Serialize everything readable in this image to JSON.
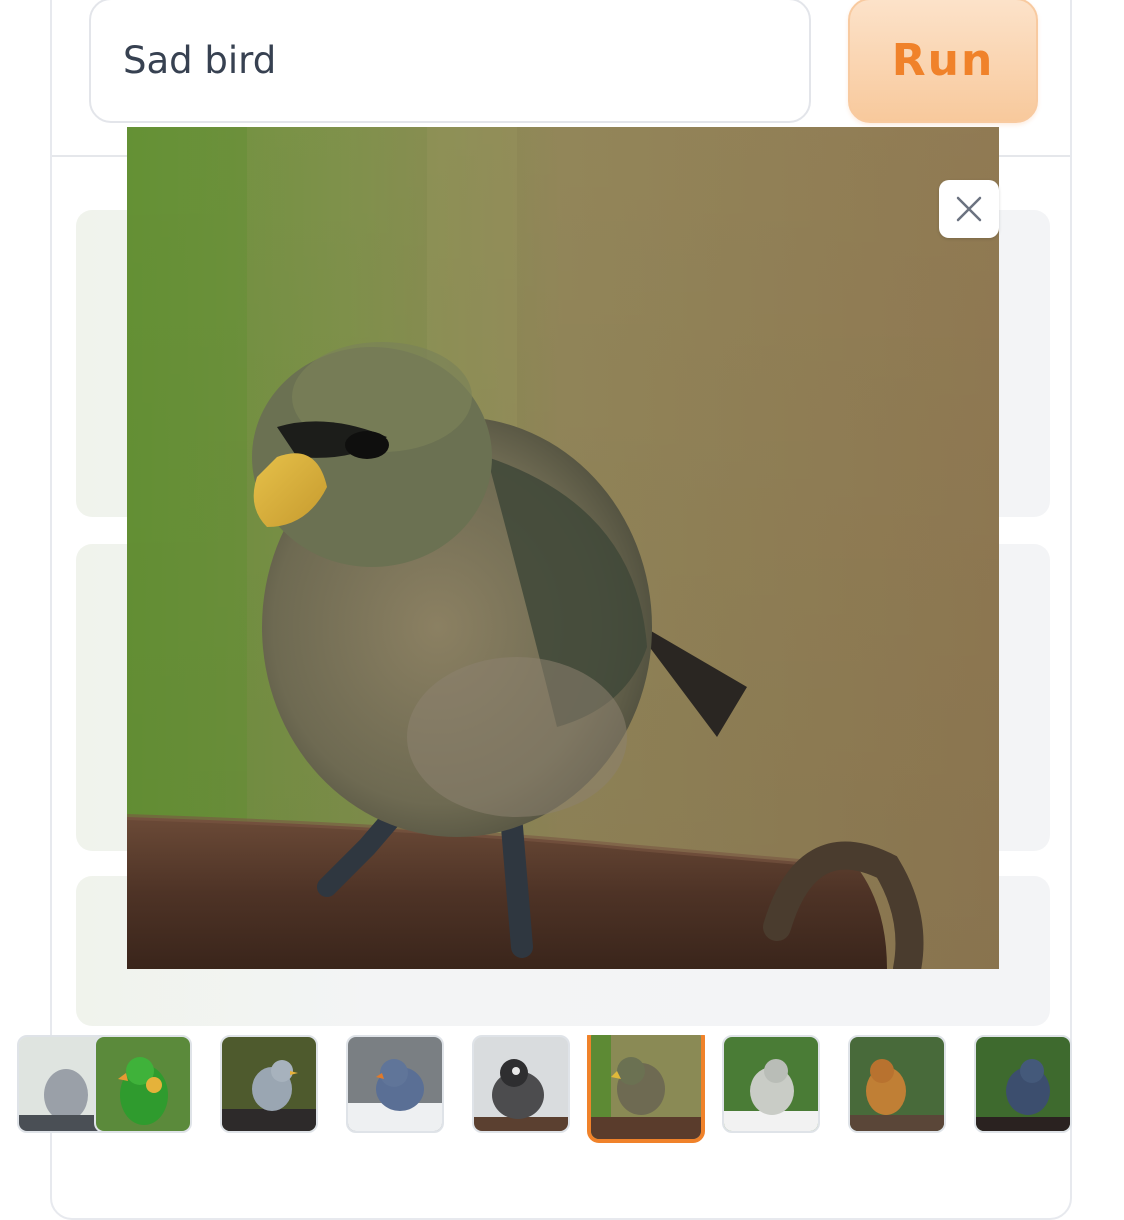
{
  "prompt": {
    "value": "Sad bird"
  },
  "run_button": {
    "label": "Run"
  },
  "close_button": {
    "icon": "close-icon"
  },
  "preview": {
    "subject": "bird-image"
  },
  "thumbnails": {
    "count": 9,
    "selected_index": 5,
    "birds": [
      "grey",
      "green-parrot",
      "grey-blue",
      "blue-orange-beak",
      "grey-dark-crest",
      "olive-yellow-beak",
      "grey-white",
      "brown-orange",
      "blue-dark"
    ]
  },
  "colors": {
    "accent": "#f0822a",
    "accent_light": "#fce2c9",
    "border": "#e5e7eb"
  }
}
